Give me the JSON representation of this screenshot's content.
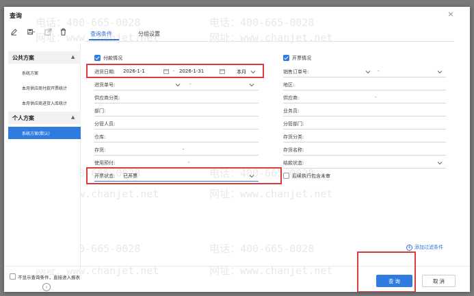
{
  "dialog": {
    "title": "查询",
    "close_glyph": "×"
  },
  "toolbar": {
    "icons": [
      "edit-icon",
      "save-icon",
      "export-icon",
      "delete-icon"
    ]
  },
  "tabs": [
    {
      "label": "查询条件"
    },
    {
      "label": "分组设置"
    }
  ],
  "sidebar": {
    "public_group": "公共方案",
    "public_items": [
      "系统方案",
      "本月供应商付款开票统计",
      "本月供应商进货入库统计"
    ],
    "private_group": "个人方案",
    "private_items": [
      "系统方案(默认)"
    ]
  },
  "form": {
    "left_section_label": "付款情况",
    "right_section_label": "开票情况",
    "rows_left": [
      {
        "label": "进货日期:",
        "value_start": "2026-1-1",
        "dash": "-",
        "value_end": "2026-1-31",
        "period": "本月"
      },
      {
        "label": "进货单号:",
        "dash": "-"
      },
      {
        "label": "供应商分类:"
      },
      {
        "label": "部门:"
      },
      {
        "label": "分管人员:"
      },
      {
        "label": "仓库:"
      },
      {
        "label": "存货:",
        "dash": "-"
      },
      {
        "label": "使用预付:",
        "dash": "-"
      },
      {
        "label": "开票状态:",
        "value": "已开票"
      }
    ],
    "rows_right": [
      {
        "label": "销售订单号:",
        "dash": "-"
      },
      {
        "label": "地区:"
      },
      {
        "label": "供应商:",
        "dash": "-"
      },
      {
        "label": "业务员:"
      },
      {
        "label": "分管部门:"
      },
      {
        "label": "存货分类:"
      },
      {
        "label": "存货名称:"
      },
      {
        "label": "结款状态:"
      },
      {
        "label": "后续执行包含未审"
      }
    ]
  },
  "add_filter": "添加过滤条件",
  "footer": {
    "checkbox_label": "不显示查询条件，直接进入报表",
    "query_button": "查 询",
    "cancel_button": "取 消"
  },
  "watermark": {
    "phone": "电话：400-665-0028",
    "site": "网址：www.chanjet.net"
  },
  "colors": {
    "accent": "#2f7be0",
    "highlight_box": "#d93a3a"
  }
}
